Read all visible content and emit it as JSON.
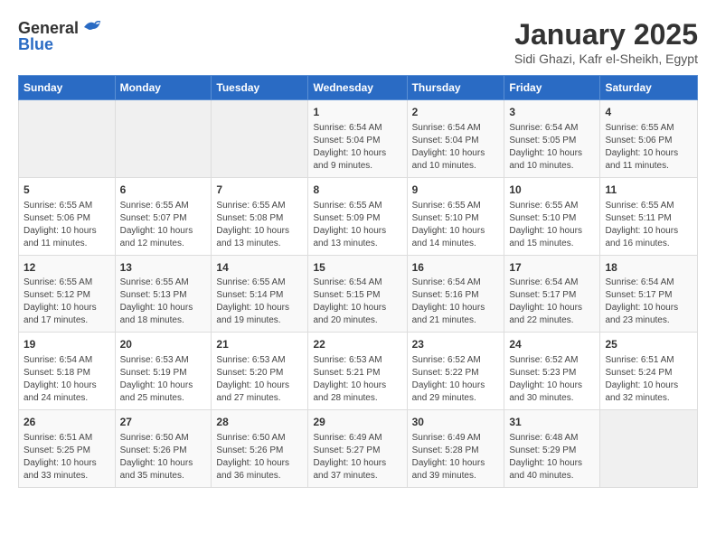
{
  "header": {
    "logo_general": "General",
    "logo_blue": "Blue",
    "title": "January 2025",
    "subtitle": "Sidi Ghazi, Kafr el-Sheikh, Egypt"
  },
  "weekdays": [
    "Sunday",
    "Monday",
    "Tuesday",
    "Wednesday",
    "Thursday",
    "Friday",
    "Saturday"
  ],
  "weeks": [
    {
      "cells": [
        {
          "empty": true
        },
        {
          "empty": true
        },
        {
          "empty": true
        },
        {
          "day": 1,
          "info": "Sunrise: 6:54 AM\nSunset: 5:04 PM\nDaylight: 10 hours\nand 9 minutes."
        },
        {
          "day": 2,
          "info": "Sunrise: 6:54 AM\nSunset: 5:04 PM\nDaylight: 10 hours\nand 10 minutes."
        },
        {
          "day": 3,
          "info": "Sunrise: 6:54 AM\nSunset: 5:05 PM\nDaylight: 10 hours\nand 10 minutes."
        },
        {
          "day": 4,
          "info": "Sunrise: 6:55 AM\nSunset: 5:06 PM\nDaylight: 10 hours\nand 11 minutes."
        }
      ]
    },
    {
      "cells": [
        {
          "day": 5,
          "info": "Sunrise: 6:55 AM\nSunset: 5:06 PM\nDaylight: 10 hours\nand 11 minutes."
        },
        {
          "day": 6,
          "info": "Sunrise: 6:55 AM\nSunset: 5:07 PM\nDaylight: 10 hours\nand 12 minutes."
        },
        {
          "day": 7,
          "info": "Sunrise: 6:55 AM\nSunset: 5:08 PM\nDaylight: 10 hours\nand 13 minutes."
        },
        {
          "day": 8,
          "info": "Sunrise: 6:55 AM\nSunset: 5:09 PM\nDaylight: 10 hours\nand 13 minutes."
        },
        {
          "day": 9,
          "info": "Sunrise: 6:55 AM\nSunset: 5:10 PM\nDaylight: 10 hours\nand 14 minutes."
        },
        {
          "day": 10,
          "info": "Sunrise: 6:55 AM\nSunset: 5:10 PM\nDaylight: 10 hours\nand 15 minutes."
        },
        {
          "day": 11,
          "info": "Sunrise: 6:55 AM\nSunset: 5:11 PM\nDaylight: 10 hours\nand 16 minutes."
        }
      ]
    },
    {
      "cells": [
        {
          "day": 12,
          "info": "Sunrise: 6:55 AM\nSunset: 5:12 PM\nDaylight: 10 hours\nand 17 minutes."
        },
        {
          "day": 13,
          "info": "Sunrise: 6:55 AM\nSunset: 5:13 PM\nDaylight: 10 hours\nand 18 minutes."
        },
        {
          "day": 14,
          "info": "Sunrise: 6:55 AM\nSunset: 5:14 PM\nDaylight: 10 hours\nand 19 minutes."
        },
        {
          "day": 15,
          "info": "Sunrise: 6:54 AM\nSunset: 5:15 PM\nDaylight: 10 hours\nand 20 minutes."
        },
        {
          "day": 16,
          "info": "Sunrise: 6:54 AM\nSunset: 5:16 PM\nDaylight: 10 hours\nand 21 minutes."
        },
        {
          "day": 17,
          "info": "Sunrise: 6:54 AM\nSunset: 5:17 PM\nDaylight: 10 hours\nand 22 minutes."
        },
        {
          "day": 18,
          "info": "Sunrise: 6:54 AM\nSunset: 5:17 PM\nDaylight: 10 hours\nand 23 minutes."
        }
      ]
    },
    {
      "cells": [
        {
          "day": 19,
          "info": "Sunrise: 6:54 AM\nSunset: 5:18 PM\nDaylight: 10 hours\nand 24 minutes."
        },
        {
          "day": 20,
          "info": "Sunrise: 6:53 AM\nSunset: 5:19 PM\nDaylight: 10 hours\nand 25 minutes."
        },
        {
          "day": 21,
          "info": "Sunrise: 6:53 AM\nSunset: 5:20 PM\nDaylight: 10 hours\nand 27 minutes."
        },
        {
          "day": 22,
          "info": "Sunrise: 6:53 AM\nSunset: 5:21 PM\nDaylight: 10 hours\nand 28 minutes."
        },
        {
          "day": 23,
          "info": "Sunrise: 6:52 AM\nSunset: 5:22 PM\nDaylight: 10 hours\nand 29 minutes."
        },
        {
          "day": 24,
          "info": "Sunrise: 6:52 AM\nSunset: 5:23 PM\nDaylight: 10 hours\nand 30 minutes."
        },
        {
          "day": 25,
          "info": "Sunrise: 6:51 AM\nSunset: 5:24 PM\nDaylight: 10 hours\nand 32 minutes."
        }
      ]
    },
    {
      "cells": [
        {
          "day": 26,
          "info": "Sunrise: 6:51 AM\nSunset: 5:25 PM\nDaylight: 10 hours\nand 33 minutes."
        },
        {
          "day": 27,
          "info": "Sunrise: 6:50 AM\nSunset: 5:26 PM\nDaylight: 10 hours\nand 35 minutes."
        },
        {
          "day": 28,
          "info": "Sunrise: 6:50 AM\nSunset: 5:26 PM\nDaylight: 10 hours\nand 36 minutes."
        },
        {
          "day": 29,
          "info": "Sunrise: 6:49 AM\nSunset: 5:27 PM\nDaylight: 10 hours\nand 37 minutes."
        },
        {
          "day": 30,
          "info": "Sunrise: 6:49 AM\nSunset: 5:28 PM\nDaylight: 10 hours\nand 39 minutes."
        },
        {
          "day": 31,
          "info": "Sunrise: 6:48 AM\nSunset: 5:29 PM\nDaylight: 10 hours\nand 40 minutes."
        },
        {
          "empty": true
        }
      ]
    }
  ]
}
